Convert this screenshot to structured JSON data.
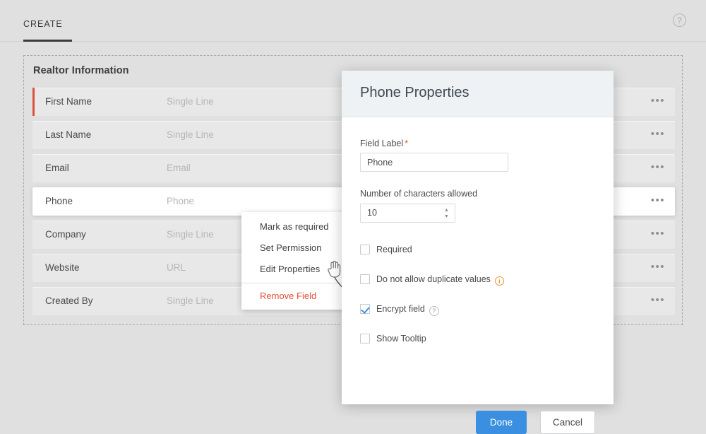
{
  "header": {
    "tab_label": "CREATE",
    "help_icon": "help-circle-icon",
    "help_glyph": "?"
  },
  "form": {
    "section_title": "Realtor Information",
    "rows": [
      {
        "label": "First Name",
        "placeholder": "Single Line",
        "required": true,
        "selected": false,
        "menu_glyph": "•••"
      },
      {
        "label": "Last Name",
        "placeholder": "Single Line",
        "required": false,
        "selected": false,
        "menu_glyph": "•••"
      },
      {
        "label": "Email",
        "placeholder": "Email",
        "required": false,
        "selected": false,
        "menu_glyph": "•••"
      },
      {
        "label": "Phone",
        "placeholder": "Phone",
        "required": false,
        "selected": true,
        "menu_glyph": "•••"
      },
      {
        "label": "Company",
        "placeholder": "Single Line",
        "required": false,
        "selected": false,
        "menu_glyph": "•••"
      },
      {
        "label": "Website",
        "placeholder": "URL",
        "required": false,
        "selected": false,
        "menu_glyph": "•••"
      },
      {
        "label": "Created By",
        "placeholder": "Single Line",
        "required": false,
        "selected": false,
        "menu_glyph": "•••"
      }
    ],
    "right_rows": [
      {
        "menu_glyph": "•••"
      },
      {
        "menu_glyph": "•••"
      },
      {
        "menu_glyph": "•••"
      }
    ]
  },
  "context_menu": {
    "items": [
      {
        "label": "Mark as required",
        "danger": false
      },
      {
        "label": "Set Permission",
        "danger": false
      },
      {
        "label": "Edit Properties",
        "danger": false
      },
      {
        "label": "Remove Field",
        "danger": true
      }
    ]
  },
  "dialog": {
    "title": "Phone Properties",
    "field_label": {
      "label": "Field Label",
      "required_marker": "*",
      "value": "Phone",
      "placeholder": "Field Label"
    },
    "char_limit": {
      "label": "Number of characters allowed",
      "value": "10",
      "stepper_up": "▲",
      "stepper_down": "▼"
    },
    "checkboxes": [
      {
        "label": "Required",
        "checked": false,
        "info": null
      },
      {
        "label": "Do not allow duplicate values",
        "checked": false,
        "info": "info-icon",
        "info_glyph": "i"
      },
      {
        "label": "Encrypt field",
        "checked": true,
        "info": "help-circle-icon",
        "info_glyph": "?"
      },
      {
        "label": "Show Tooltip",
        "checked": false,
        "info": null
      }
    ],
    "buttons": {
      "done": "Done",
      "cancel": "Cancel"
    }
  },
  "colors": {
    "page_background": "#e0e0e0",
    "row_background": "#e8e8e8",
    "required_bar": "#e0513b",
    "primary_button": "#3b8fe0",
    "danger_text": "#e0513b",
    "info_icon": "#e8952e",
    "dialog_header": "#eff2f4"
  }
}
